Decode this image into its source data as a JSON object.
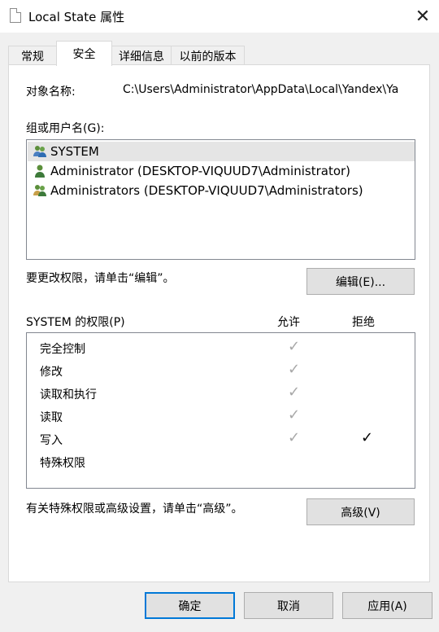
{
  "window": {
    "title": "Local State 属性",
    "close_glyph": "✕"
  },
  "tabs": [
    {
      "label": "常规",
      "active": false
    },
    {
      "label": "安全",
      "active": true
    },
    {
      "label": "详细信息",
      "active": false
    },
    {
      "label": "以前的版本",
      "active": false
    }
  ],
  "object": {
    "label": "对象名称:",
    "path": "C:\\Users\\Administrator\\AppData\\Local\\Yandex\\Ya"
  },
  "groups": {
    "label": "组或用户名(G):",
    "items": [
      {
        "name": "SYSTEM",
        "icon": "group-users-icon",
        "selected": true
      },
      {
        "name": "Administrator (DESKTOP-VIQUUD7\\Administrator)",
        "icon": "user-icon",
        "selected": false
      },
      {
        "name": "Administrators (DESKTOP-VIQUUD7\\Administrators)",
        "icon": "group-users-icon",
        "selected": false
      }
    ]
  },
  "edit": {
    "hint": "要更改权限，请单击“编辑”。",
    "button": "编辑(E)..."
  },
  "permissions": {
    "title": "SYSTEM 的权限(P)",
    "allow_header": "允许",
    "deny_header": "拒绝",
    "check_glyph": "✓",
    "rows": [
      {
        "name": "完全控制",
        "allow": true,
        "deny": false
      },
      {
        "name": "修改",
        "allow": true,
        "deny": false
      },
      {
        "name": "读取和执行",
        "allow": true,
        "deny": false
      },
      {
        "name": "读取",
        "allow": true,
        "deny": false
      },
      {
        "name": "写入",
        "allow": true,
        "deny": true
      },
      {
        "name": "特殊权限",
        "allow": false,
        "deny": false
      }
    ]
  },
  "advanced": {
    "hint": "有关特殊权限或高级设置，请单击“高级”。",
    "button": "高级(V)"
  },
  "footer": {
    "ok": "确定",
    "cancel": "取消",
    "apply": "应用(A)"
  },
  "colors": {
    "accent": "#0078d7",
    "selected_row": "#e5e5e5",
    "allow_check": "#a8a8a8"
  }
}
